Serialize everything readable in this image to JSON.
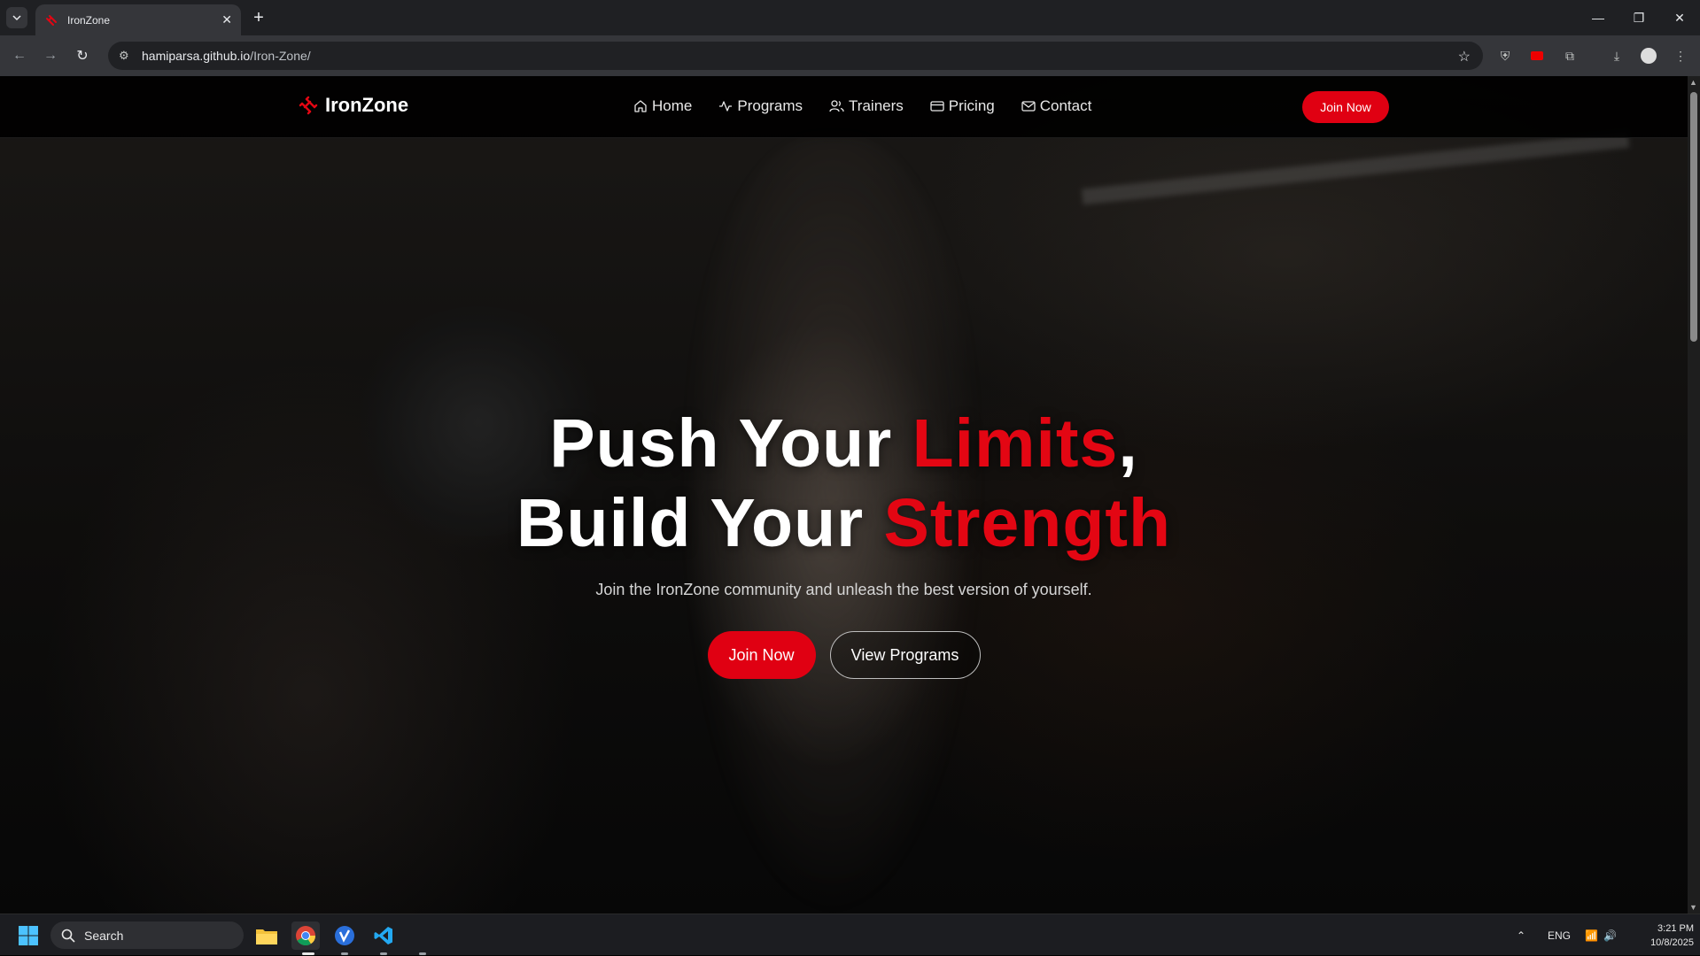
{
  "browser": {
    "tab_title": "IronZone",
    "url_host": "hamiparsa.github.io",
    "url_path": "/Iron-Zone/"
  },
  "nav": {
    "brand": "IronZone",
    "links": [
      {
        "label": "Home",
        "icon": "home-icon"
      },
      {
        "label": "Programs",
        "icon": "activity-icon"
      },
      {
        "label": "Trainers",
        "icon": "users-icon"
      },
      {
        "label": "Pricing",
        "icon": "credit-card-icon"
      },
      {
        "label": "Contact",
        "icon": "mail-icon"
      }
    ],
    "join_label": "Join Now"
  },
  "hero": {
    "line1_a": "Push Your ",
    "line1_b": "Limits",
    "line1_c": ",",
    "line2_a": "Build Your ",
    "line2_b": "Strength",
    "subtitle": "Join the IronZone community and unleash the best version of yourself.",
    "primary_cta": "Join Now",
    "secondary_cta": "View Programs"
  },
  "taskbar": {
    "search_label": "Search",
    "lang": "ENG",
    "time": "3:21 PM",
    "date": "10/8/2025"
  },
  "colors": {
    "accent": "#e00012",
    "background": "#000000"
  }
}
